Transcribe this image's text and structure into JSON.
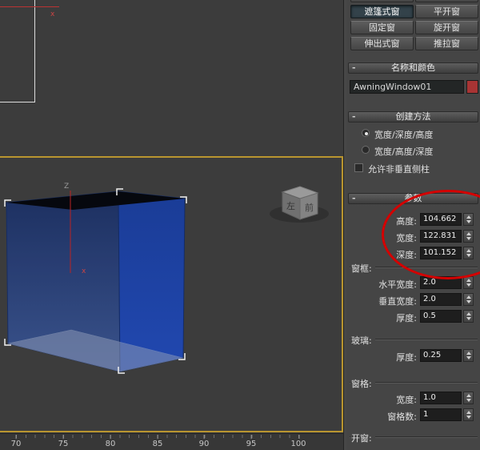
{
  "colors": {
    "active_viewport_border": "#b9952f",
    "annotation": "#d40000",
    "object_color_swatch": "#a83434",
    "window_object_blue": "#1d43a4"
  },
  "viewport": {
    "axis_z": "Z",
    "axis_x": "x",
    "top_view_axis_x": "x",
    "viewcube": {
      "left_face": "左",
      "front_face": "前"
    },
    "ruler_ticks": [
      "70",
      "75",
      "80",
      "85",
      "90",
      "95",
      "100"
    ]
  },
  "panel": {
    "object_buttons": [
      "遮篷式窗",
      "平开窗",
      "固定窗",
      "旋开窗",
      "伸出式窗",
      "推拉窗"
    ],
    "name_color": {
      "title": "名称和颜色",
      "name_value": "AwningWindow01"
    },
    "creation_method": {
      "title": "创建方法",
      "radio_wdh": "宽度/深度/高度",
      "radio_whd": "宽度/高度/深度",
      "checkbox_label": "允许非垂直侧柱"
    },
    "parameters": {
      "title": "参数",
      "height_label": "高度:",
      "height_value": "104.662",
      "width_label": "宽度:",
      "width_value": "122.831",
      "depth_label": "深度:",
      "depth_value": "101.152",
      "frame": {
        "section": "窗框:",
        "h_label": "水平宽度:",
        "h_value": "2.0",
        "v_label": "垂直宽度:",
        "v_value": "2.0",
        "t_label": "厚度:",
        "t_value": "0.5"
      },
      "glazing": {
        "section": "玻璃:",
        "t_label": "厚度:",
        "t_value": "0.25"
      },
      "rails": {
        "section": "窗格:",
        "w_label": "宽度:",
        "w_value": "1.0",
        "count_label": "窗格数:",
        "count_value": "1"
      },
      "open": {
        "section": "开窗:"
      }
    }
  }
}
